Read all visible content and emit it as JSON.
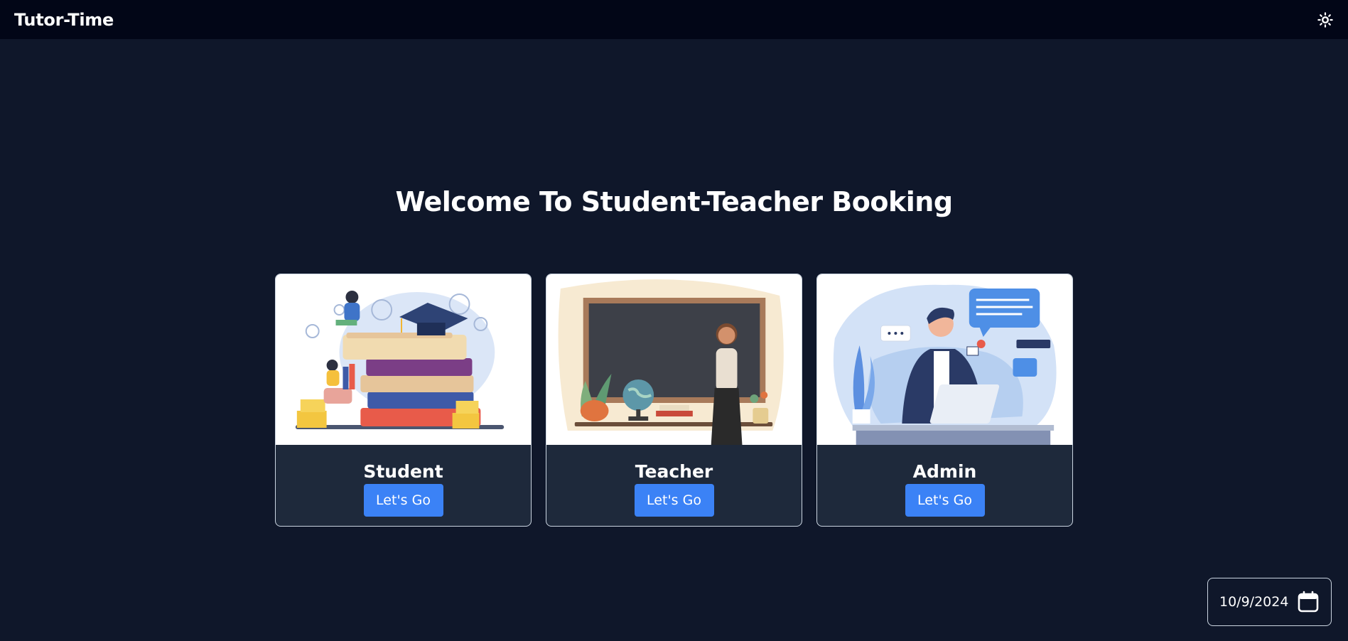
{
  "header": {
    "brand": "Tutor-Time",
    "theme_icon": "sun-icon"
  },
  "main": {
    "title": "Welcome To Student-Teacher Booking",
    "cards": [
      {
        "label": "Student",
        "button": "Let's Go",
        "image": "student-illustration"
      },
      {
        "label": "Teacher",
        "button": "Let's Go",
        "image": "teacher-illustration"
      },
      {
        "label": "Admin",
        "button": "Let's Go",
        "image": "admin-illustration"
      }
    ]
  },
  "date": {
    "value": "10/9/2024",
    "icon": "calendar-icon"
  },
  "colors": {
    "background": "#0f172a",
    "topbar": "#020617",
    "card_body": "#1e293b",
    "button": "#3b82f6"
  }
}
